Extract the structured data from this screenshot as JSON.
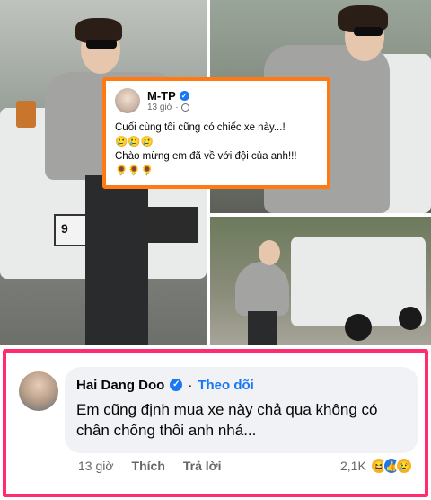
{
  "post": {
    "author": "M-TP",
    "time": "13 giờ",
    "line1": "Cuối cùng tôi cũng có chiếc xe này...!",
    "emojis1": "🥲🥲🥲",
    "line2": "Chào mừng em đã về với đội của anh!!!",
    "emojis2": "🌻🌻🌻"
  },
  "photos": {
    "plate_text": "9"
  },
  "comment": {
    "author": "Hai Dang Doo",
    "follow_label": "Theo dõi",
    "separator": "·",
    "text": "Em cũng định mua xe này chả qua không có chân chống thôi anh nhá...",
    "time": "13 giờ",
    "like_label": "Thích",
    "reply_label": "Trả lời",
    "reaction_count": "2,1K",
    "reaction_icons": [
      "haha-icon",
      "like-icon",
      "sad-icon"
    ]
  },
  "colors": {
    "post_border": "#ff7a12",
    "comment_border": "#ff2d6f",
    "fb_blue": "#1877f2"
  }
}
